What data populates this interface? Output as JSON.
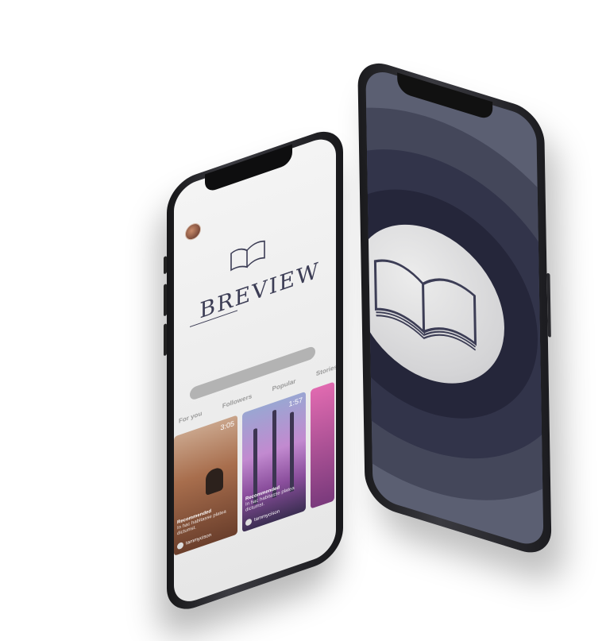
{
  "app": {
    "brand": "BREVIEW"
  },
  "tabs": [
    "For you",
    "Followers",
    "Popular",
    "Stories"
  ],
  "cards": [
    {
      "duration": "3:05",
      "username": "Recommended",
      "caption": "In hac habitasse platea dictumst.",
      "author": "tammycison"
    },
    {
      "duration": "1:57",
      "username": "Recommended",
      "caption": "In hac habitasse platea dictumst.",
      "author": "tammycison"
    }
  ],
  "colors": {
    "brand": "#3c3d55",
    "back_screen": "#5b5f72",
    "ring_dark": "#25263a"
  },
  "icons": {
    "logo": "open-book-icon",
    "back_logo": "open-book-icon"
  }
}
